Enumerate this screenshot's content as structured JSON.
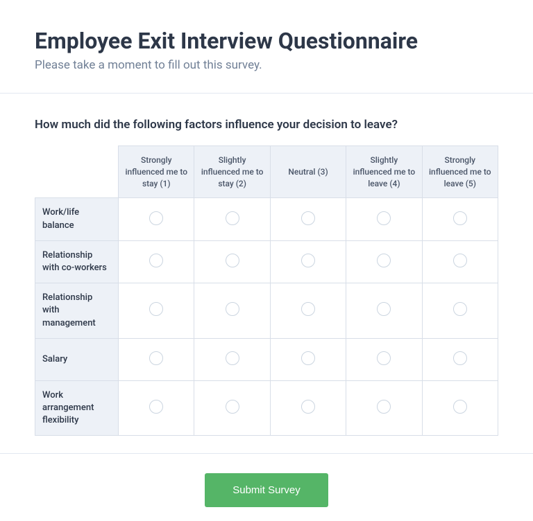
{
  "header": {
    "title": "Employee Exit Interview Questionnaire",
    "subtitle": "Please take a moment to fill out this survey."
  },
  "question": {
    "text": "How much did the following factors influence your decision to leave?",
    "columns": [
      "Strongly influenced me to stay (1)",
      "Slightly influenced me to stay (2)",
      "Neutral (3)",
      "Slightly influenced me to leave (4)",
      "Strongly influenced me to leave (5)"
    ],
    "rows": [
      "Work/life balance",
      "Relationship with co-workers",
      "Relationship with management",
      "Salary",
      "Work arrangement flexibility"
    ]
  },
  "footer": {
    "submit_label": "Submit Survey"
  }
}
